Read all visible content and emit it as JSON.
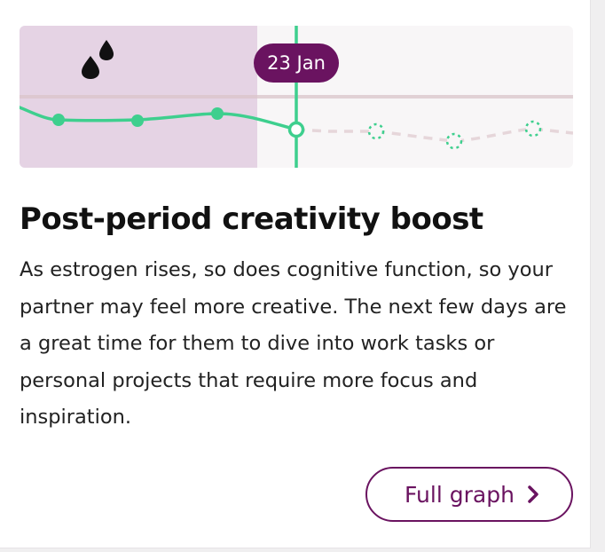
{
  "card": {
    "date_label": "23 Jan",
    "phase_icon": "period-drops-icon",
    "title": "Post-period creativity boost",
    "body": "As estrogen rises, so does cognitive function, so your partner may feel more creative. The next few days are a great time for them to dive into work tasks or personal projects that require more focus and inspiration.",
    "full_graph_label": "Full graph",
    "full_graph_icon": "chevron-right-icon"
  },
  "colors": {
    "period_bg": "#e5d3e4",
    "chart_bg": "#f8f6f7",
    "accent_green": "#3ecf8e",
    "brand_purple": "#6a1360",
    "forecast_line": "#e6d6da"
  }
}
